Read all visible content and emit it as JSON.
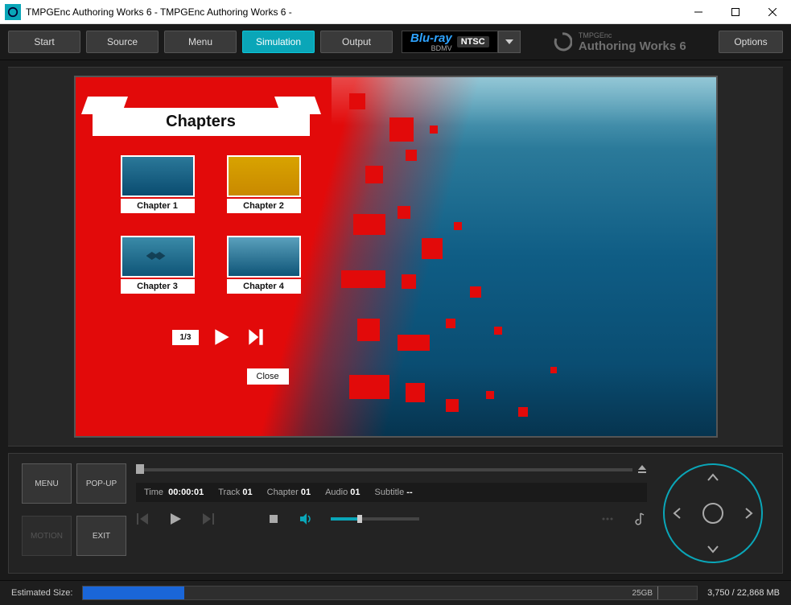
{
  "window": {
    "title": "TMPGEnc Authoring Works 6 - TMPGEnc Authoring Works 6 -"
  },
  "toolbar": {
    "tabs": [
      "Start",
      "Source",
      "Menu",
      "Simulation",
      "Output"
    ],
    "active_tab": "Simulation",
    "bluray": "Blu-ray",
    "bdmv": "BDMV",
    "standard": "NTSC",
    "brand_top": "TMPGEnc",
    "brand_main": "Authoring Works 6",
    "options": "Options"
  },
  "disc_menu": {
    "title": "Chapters",
    "chapters": [
      "Chapter 1",
      "Chapter 2",
      "Chapter 3",
      "Chapter 4"
    ],
    "page": "1/3",
    "close": "Close"
  },
  "controls": {
    "menu": "MENU",
    "popup": "POP-UP",
    "motion": "MOTION",
    "exit": "EXIT",
    "time_label": "Time",
    "time_value": "00:00:01",
    "track_label": "Track",
    "track_value": "01",
    "chapter_label": "Chapter",
    "chapter_value": "01",
    "audio_label": "Audio",
    "audio_value": "01",
    "subtitle_label": "Subtitle",
    "subtitle_value": "--"
  },
  "status": {
    "label": "Estimated Size:",
    "capacity": "25GB",
    "size_text": "3,750 / 22,868 MB"
  }
}
